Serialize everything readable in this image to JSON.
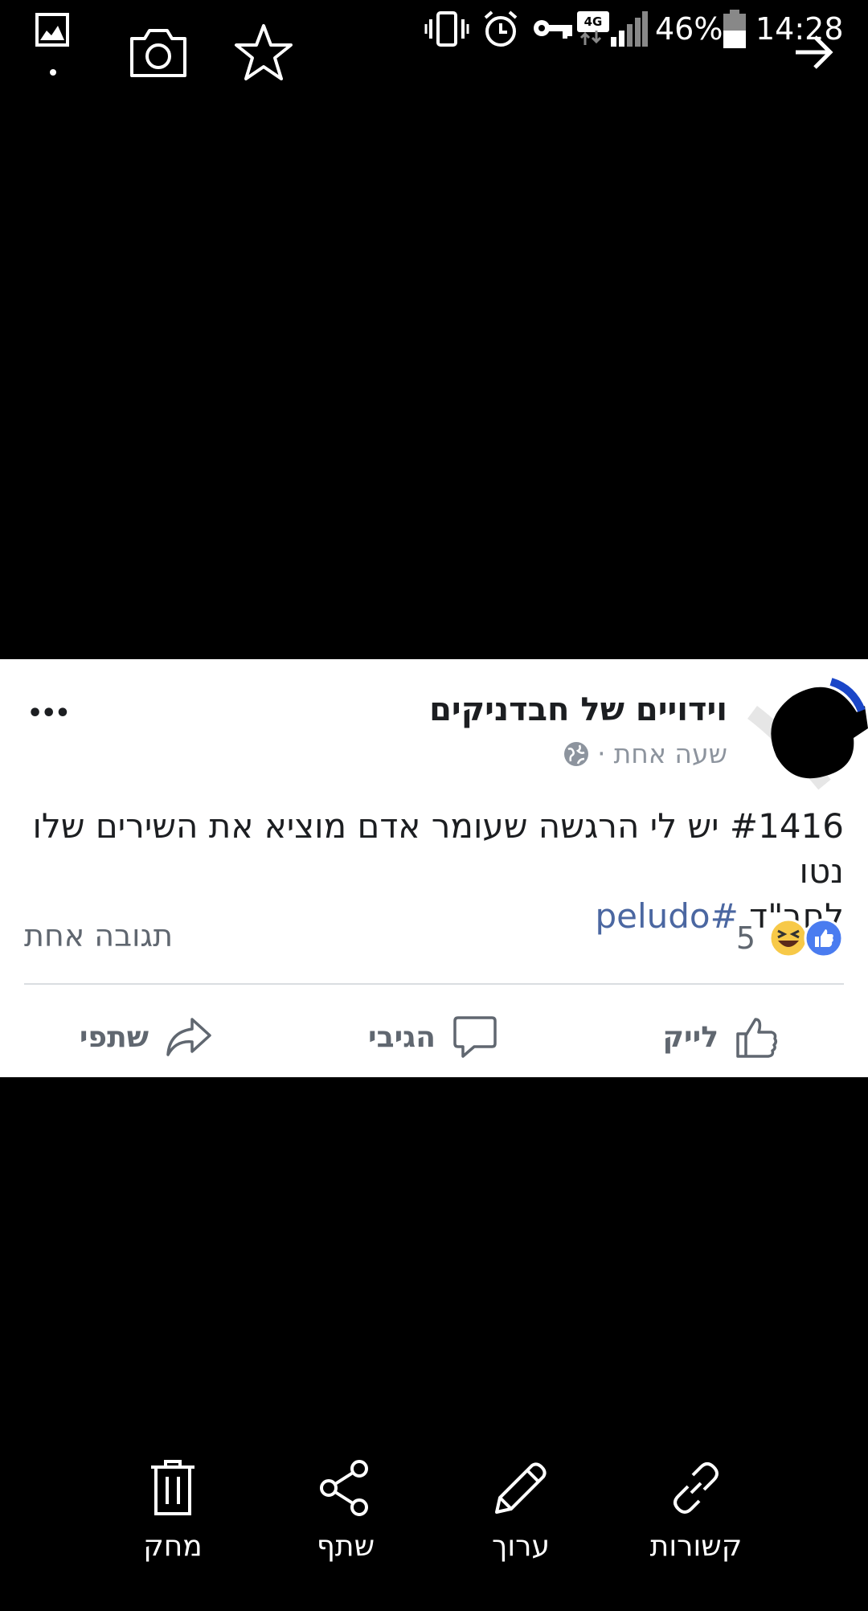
{
  "status_bar": {
    "battery": "46%",
    "time": "14:28",
    "network": "4G"
  },
  "post": {
    "page_name": "וידויים של חבדניקים",
    "timestamp": "שעה אחת",
    "separator": "·",
    "text_main": "#1416 יש לי הרגשה שעומר אדם מוציא את השירים שלו נטו",
    "text_second": "לחב\"ד ",
    "hashtag": "#peludo",
    "comments": "תגובה אחת",
    "reaction_count": "5",
    "actions": {
      "like": "לייק",
      "comment": "הגיבי",
      "share": "שתפי"
    },
    "more": "•••"
  },
  "bottom_bar": {
    "delete": "מחק",
    "share": "שתף",
    "edit": "ערוך",
    "links": "קשורות"
  },
  "colors": {
    "hashtag": "#4b67a1",
    "like_blue": "#4a7cf0",
    "haha_yellow": "#f7c948"
  }
}
